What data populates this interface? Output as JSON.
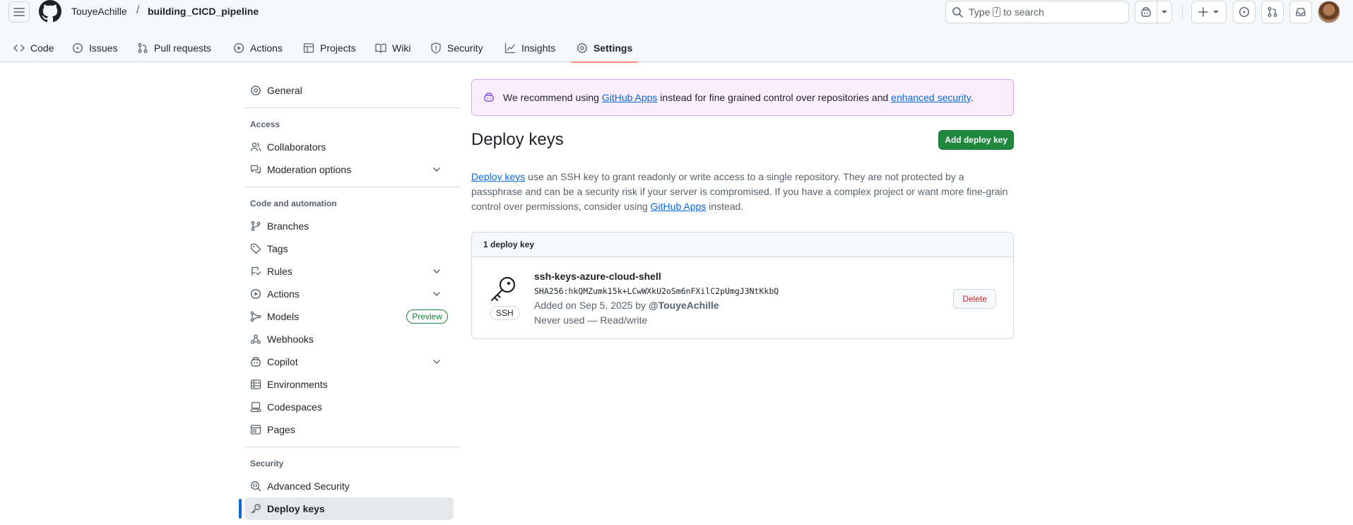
{
  "header": {
    "owner": "TouyeAchille",
    "separator": "/",
    "repo": "building_CICD_pipeline",
    "search": {
      "before": "Type",
      "kbd": "/",
      "after": "to search"
    }
  },
  "tabs": [
    {
      "label": "Code",
      "icon": "code-icon"
    },
    {
      "label": "Issues",
      "icon": "issue-opened-icon"
    },
    {
      "label": "Pull requests",
      "icon": "git-pull-request-icon"
    },
    {
      "label": "Actions",
      "icon": "play-icon"
    },
    {
      "label": "Projects",
      "icon": "table-icon"
    },
    {
      "label": "Wiki",
      "icon": "book-icon"
    },
    {
      "label": "Security",
      "icon": "shield-icon"
    },
    {
      "label": "Insights",
      "icon": "graph-icon"
    },
    {
      "label": "Settings",
      "icon": "gear-icon",
      "active": true
    }
  ],
  "sidebar": {
    "general": "General",
    "sections": {
      "access": "Access",
      "code_automation": "Code and automation",
      "security": "Security"
    },
    "items": {
      "collaborators": "Collaborators",
      "moderation": "Moderation options",
      "branches": "Branches",
      "tags": "Tags",
      "rules": "Rules",
      "actions": "Actions",
      "models": "Models",
      "models_badge": "Preview",
      "webhooks": "Webhooks",
      "copilot": "Copilot",
      "environments": "Environments",
      "codespaces": "Codespaces",
      "pages": "Pages",
      "advanced_security": "Advanced Security",
      "deploy_keys": "Deploy keys"
    }
  },
  "main": {
    "flash": {
      "pre": "We recommend using ",
      "link1": "GitHub Apps",
      "mid": " instead for fine grained control over repositories and ",
      "link2": "enhanced security",
      "post": "."
    },
    "title": "Deploy keys",
    "add_button": "Add deploy key",
    "description": {
      "link1": "Deploy keys",
      "text1": " use an SSH key to grant readonly or write access to a single repository. They are not protected by a passphrase and can be a security risk if your server is compromised. If you have a complex project or want more fine-grain control over permissions, consider using ",
      "link2": "GitHub Apps",
      "text2": " instead."
    },
    "box_header": "1 deploy key",
    "key": {
      "type_label": "SSH",
      "title": "ssh-keys-azure-cloud-shell",
      "fingerprint": "SHA256:hkQMZumk15k+LCwWXkU2oSm6nFXilC2pUmgJ3NtKkbQ",
      "added_prefix": "Added on Sep 5, 2025 by ",
      "added_by": "@TouyeAchille",
      "usage": "Never used — Read/write",
      "delete_label": "Delete"
    }
  }
}
